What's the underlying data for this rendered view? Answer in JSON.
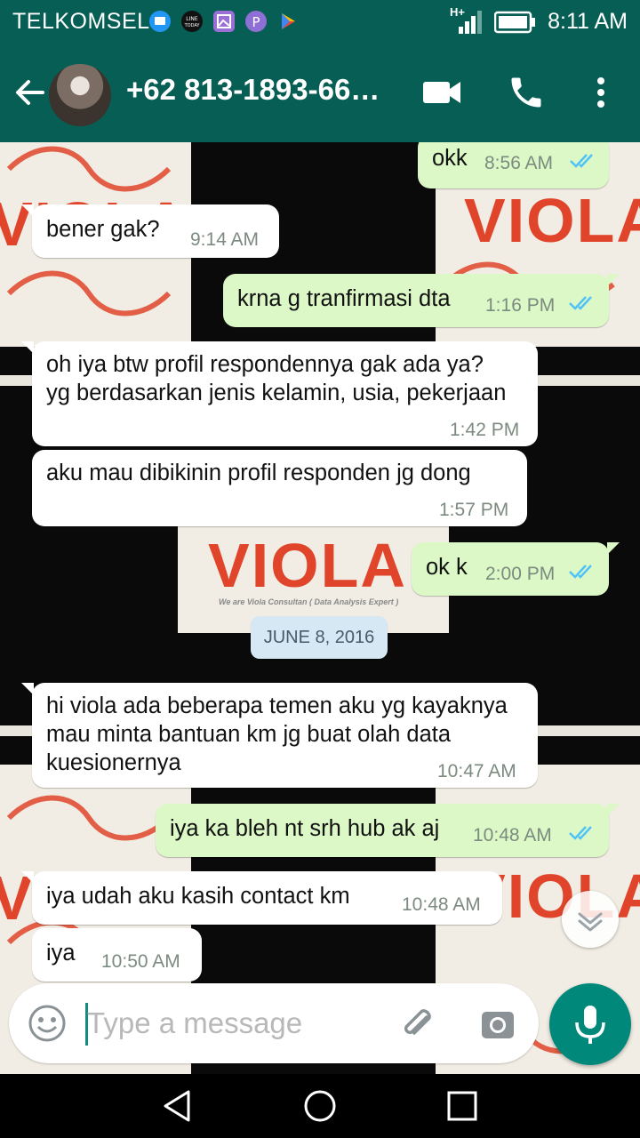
{
  "status_bar": {
    "carrier": "TELKOMSEL",
    "network": "H+",
    "time": "8:11 AM",
    "icons": [
      "message-icon",
      "line-today-icon",
      "gallery-icon",
      "p-app-icon",
      "play-store-icon",
      "signal-icon",
      "battery-icon"
    ]
  },
  "header": {
    "contact": "+62 813-1893-66…",
    "actions": [
      "back-arrow-icon",
      "video-call-icon",
      "phone-call-icon",
      "more-options-icon"
    ]
  },
  "messages": [
    {
      "dir": "out",
      "text": "okk",
      "time": "8:56 AM",
      "status": "read"
    },
    {
      "dir": "in",
      "text": "bener gak?",
      "time": "9:14 AM"
    },
    {
      "dir": "out",
      "text": "krna g tranfirmasi dta",
      "time": "1:16 PM",
      "status": "read"
    },
    {
      "dir": "in",
      "text": "oh iya btw profil respondennya gak ada ya? yg berdasarkan jenis kelamin, usia, pekerjaan",
      "time": "1:42 PM"
    },
    {
      "dir": "in",
      "text": "aku mau dibikinin profil responden jg dong",
      "time": "1:57 PM"
    },
    {
      "dir": "out",
      "text": "ok k",
      "time": "2:00 PM",
      "status": "read"
    },
    {
      "dir": "in",
      "text": "hi viola ada beberapa temen aku yg kayaknya mau minta bantuan km jg buat olah data kuesionernya",
      "time": "10:47 AM"
    },
    {
      "dir": "out",
      "text": "iya ka bleh nt srh hub ak aj",
      "time": "10:48 AM",
      "status": "read"
    },
    {
      "dir": "in",
      "text": "iya udah aku kasih contact km",
      "time": "10:48 AM"
    },
    {
      "dir": "in",
      "text": "iya",
      "time": "10:50 AM"
    }
  ],
  "date_chip": "JUNE 8, 2016",
  "wallpaper": {
    "brand": "VIOLA",
    "tagline": "We are Viola Consultan ( Data Analysis Expert )"
  },
  "input": {
    "placeholder": "Type a message"
  },
  "colors": {
    "header": "#075e54",
    "outgoing_bubble": "#dcf8c6",
    "incoming_bubble": "#ffffff",
    "read_ticks": "#4fc3f7",
    "mic_button": "#00897b"
  }
}
